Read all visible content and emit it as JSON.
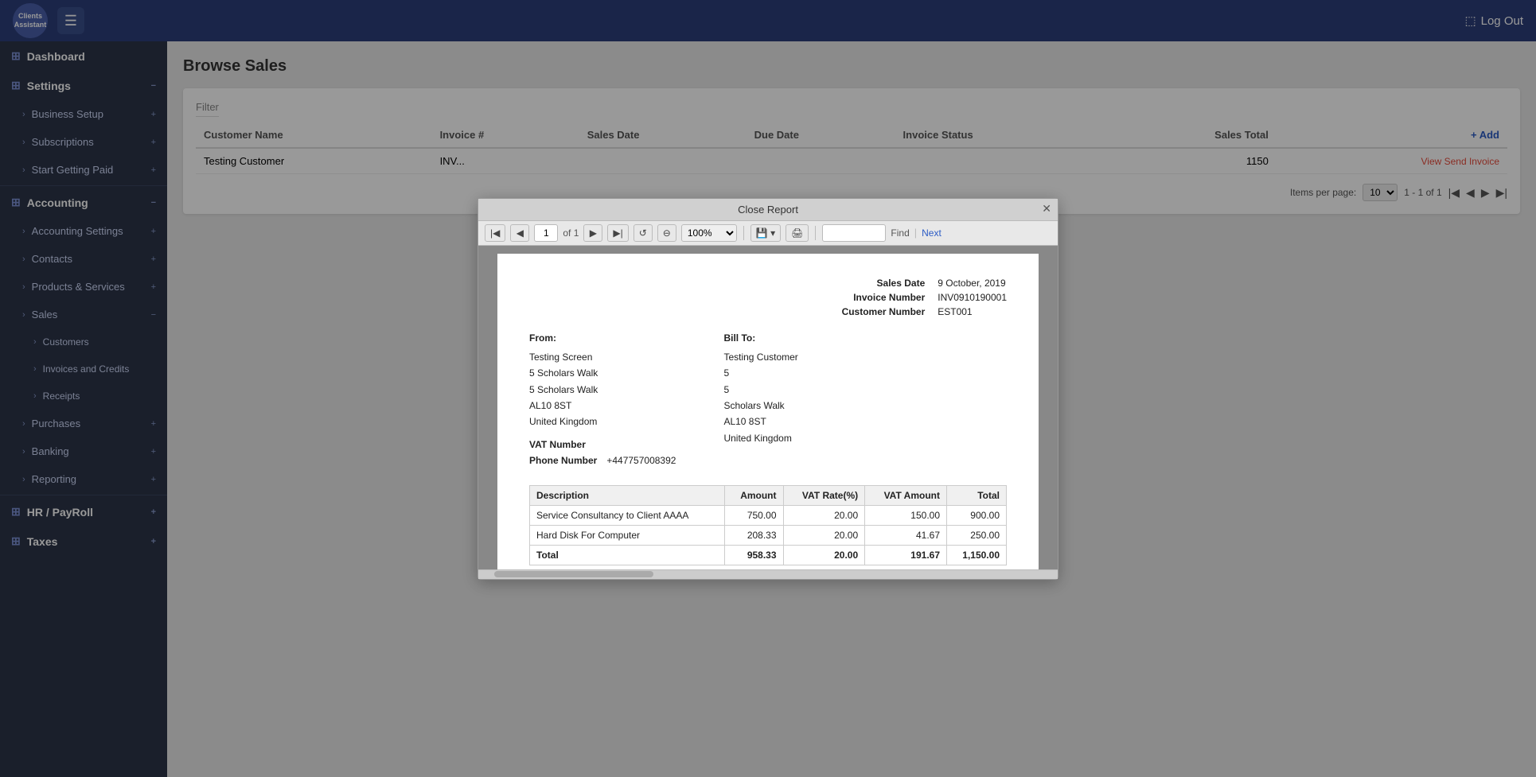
{
  "app": {
    "name": "Clients Assistant",
    "logout_label": "Log Out"
  },
  "sidebar": {
    "items": [
      {
        "id": "dashboard",
        "label": "Dashboard",
        "icon": "⊞",
        "type": "top",
        "expandable": false
      },
      {
        "id": "settings",
        "label": "Settings",
        "icon": "⊞",
        "type": "section",
        "expanded": true,
        "minus": true
      },
      {
        "id": "business-setup",
        "label": "Business Setup",
        "type": "sub",
        "expandable": true
      },
      {
        "id": "subscriptions",
        "label": "Subscriptions",
        "type": "sub",
        "expandable": true
      },
      {
        "id": "start-getting-paid",
        "label": "Start Getting Paid",
        "type": "sub",
        "expandable": true
      },
      {
        "id": "accounting",
        "label": "Accounting",
        "icon": "⊞",
        "type": "section",
        "expanded": true,
        "minus": true
      },
      {
        "id": "accounting-settings",
        "label": "Accounting Settings",
        "type": "sub",
        "expandable": true
      },
      {
        "id": "contacts",
        "label": "Contacts",
        "type": "sub",
        "expandable": true
      },
      {
        "id": "products-services",
        "label": "Products & Services",
        "type": "sub",
        "expandable": true
      },
      {
        "id": "sales",
        "label": "Sales",
        "type": "sub",
        "expanded": true,
        "minus": true
      },
      {
        "id": "customers",
        "label": "Customers",
        "type": "subsub",
        "expandable": true
      },
      {
        "id": "invoices-credits",
        "label": "Invoices and Credits",
        "type": "subsub",
        "expandable": true
      },
      {
        "id": "receipts",
        "label": "Receipts",
        "type": "subsub",
        "expandable": true
      },
      {
        "id": "purchases",
        "label": "Purchases",
        "type": "sub",
        "expandable": true
      },
      {
        "id": "banking",
        "label": "Banking",
        "type": "sub",
        "expandable": true
      },
      {
        "id": "reporting",
        "label": "Reporting",
        "type": "sub",
        "expandable": true
      },
      {
        "id": "hr-payroll",
        "label": "HR / PayRoll",
        "icon": "⊞",
        "type": "section",
        "expanded": false,
        "plus": true
      },
      {
        "id": "taxes",
        "label": "Taxes",
        "icon": "⊞",
        "type": "section",
        "expanded": false,
        "plus": true
      }
    ]
  },
  "browse_sales": {
    "title": "Browse Sales",
    "filter_label": "Filter",
    "columns": [
      "Customer Name",
      "Invoice #",
      "Sales Date",
      "Due Date",
      "Invoice Status",
      "Sales Total",
      ""
    ],
    "rows": [
      {
        "customer_name": "Testing Customer",
        "invoice_num": "INV...",
        "sales_total": "1150",
        "action": "View Send Invoice"
      }
    ],
    "add_label": "+ Add",
    "items_per_page_label": "Items per page:",
    "per_page_value": "10",
    "pagination_info": "1 - 1 of 1"
  },
  "report_modal": {
    "title": "Close Report",
    "page_num": "1",
    "of_label": "of 1",
    "zoom": "100%",
    "find_placeholder": "",
    "find_label": "Find",
    "next_label": "Next",
    "invoice": {
      "sales_date_label": "Sales Date",
      "sales_date_value": "9 October, 2019",
      "invoice_number_label": "Invoice Number",
      "invoice_number_value": "INV0910190001",
      "customer_number_label": "Customer Number",
      "customer_number_value": "EST001",
      "from_label": "From:",
      "from_company": "Testing Screen",
      "from_addr1": "5 Scholars Walk",
      "from_addr2": "5 Scholars Walk",
      "from_postcode": "AL10 8ST",
      "from_country": "United Kingdom",
      "vat_label": "VAT Number",
      "phone_label": "Phone Number",
      "phone_value": "+447757008392",
      "bill_to_label": "Bill To:",
      "bill_company": "Testing Customer",
      "bill_addr1": "5",
      "bill_addr2": "5",
      "bill_addr3": "Scholars Walk",
      "bill_postcode": "AL10 8ST",
      "bill_country": "United Kingdom",
      "table_headers": [
        "Description",
        "Amount",
        "VAT Rate(%)",
        "VAT Amount",
        "Total"
      ],
      "line_items": [
        {
          "description": "Service Consultancy to Client AAAA",
          "amount": "750.00",
          "vat_rate": "20.00",
          "vat_amount": "150.00",
          "total": "900.00"
        },
        {
          "description": "Hard Disk For Computer",
          "amount": "208.33",
          "vat_rate": "20.00",
          "vat_amount": "41.67",
          "total": "250.00"
        }
      ],
      "totals_row": {
        "label": "Total",
        "amount": "958.33",
        "vat_rate": "20.00",
        "vat_amount": "191.67",
        "total": "1,150.00"
      }
    }
  }
}
